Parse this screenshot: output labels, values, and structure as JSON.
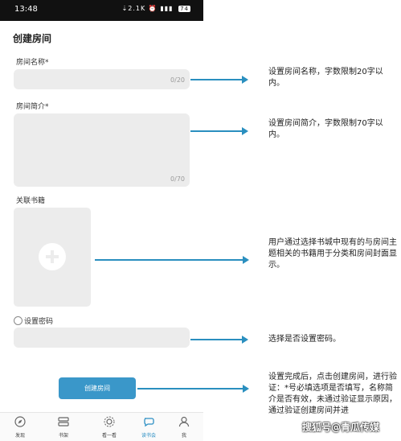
{
  "status_bar": {
    "time": "13:48",
    "icons": "⇣2.1K ⏰ ▮▮▮",
    "battery": "74"
  },
  "page_title": "创建房间",
  "room_name": {
    "label": "房间名称*",
    "counter": "0/20"
  },
  "room_intro": {
    "label": "房间简介*",
    "counter": "0/70"
  },
  "books": {
    "label": "关联书籍"
  },
  "password": {
    "label": "设置密码"
  },
  "create_button": "创建房间",
  "nav": [
    {
      "label": "发现",
      "icon": "compass-icon"
    },
    {
      "label": "书架",
      "icon": "bookshelf-icon"
    },
    {
      "label": "看一看",
      "icon": "gear-icon"
    },
    {
      "label": "读书会",
      "icon": "chat-icon"
    },
    {
      "label": "我",
      "icon": "user-icon"
    }
  ],
  "annotations": {
    "name": "设置房间名称，字数限制20字以内。",
    "intro": "设置房间简介，字数限制70字以内。",
    "books": "用户通过选择书城中现有的与房间主题相关的书籍用于分类和房间封面显示。",
    "password": "选择是否设置密码。",
    "create": "设置完成后，点击创建房间，进行验证：*号必填选项是否填写，名称简介是否有效，未通过验证显示原因，通过验证创建房间并进"
  },
  "watermark": "搜狐号@青瓜传媒",
  "colors": {
    "accent": "#3a97c9",
    "arrow": "#2a8fbf",
    "field_bg": "#ececec"
  }
}
